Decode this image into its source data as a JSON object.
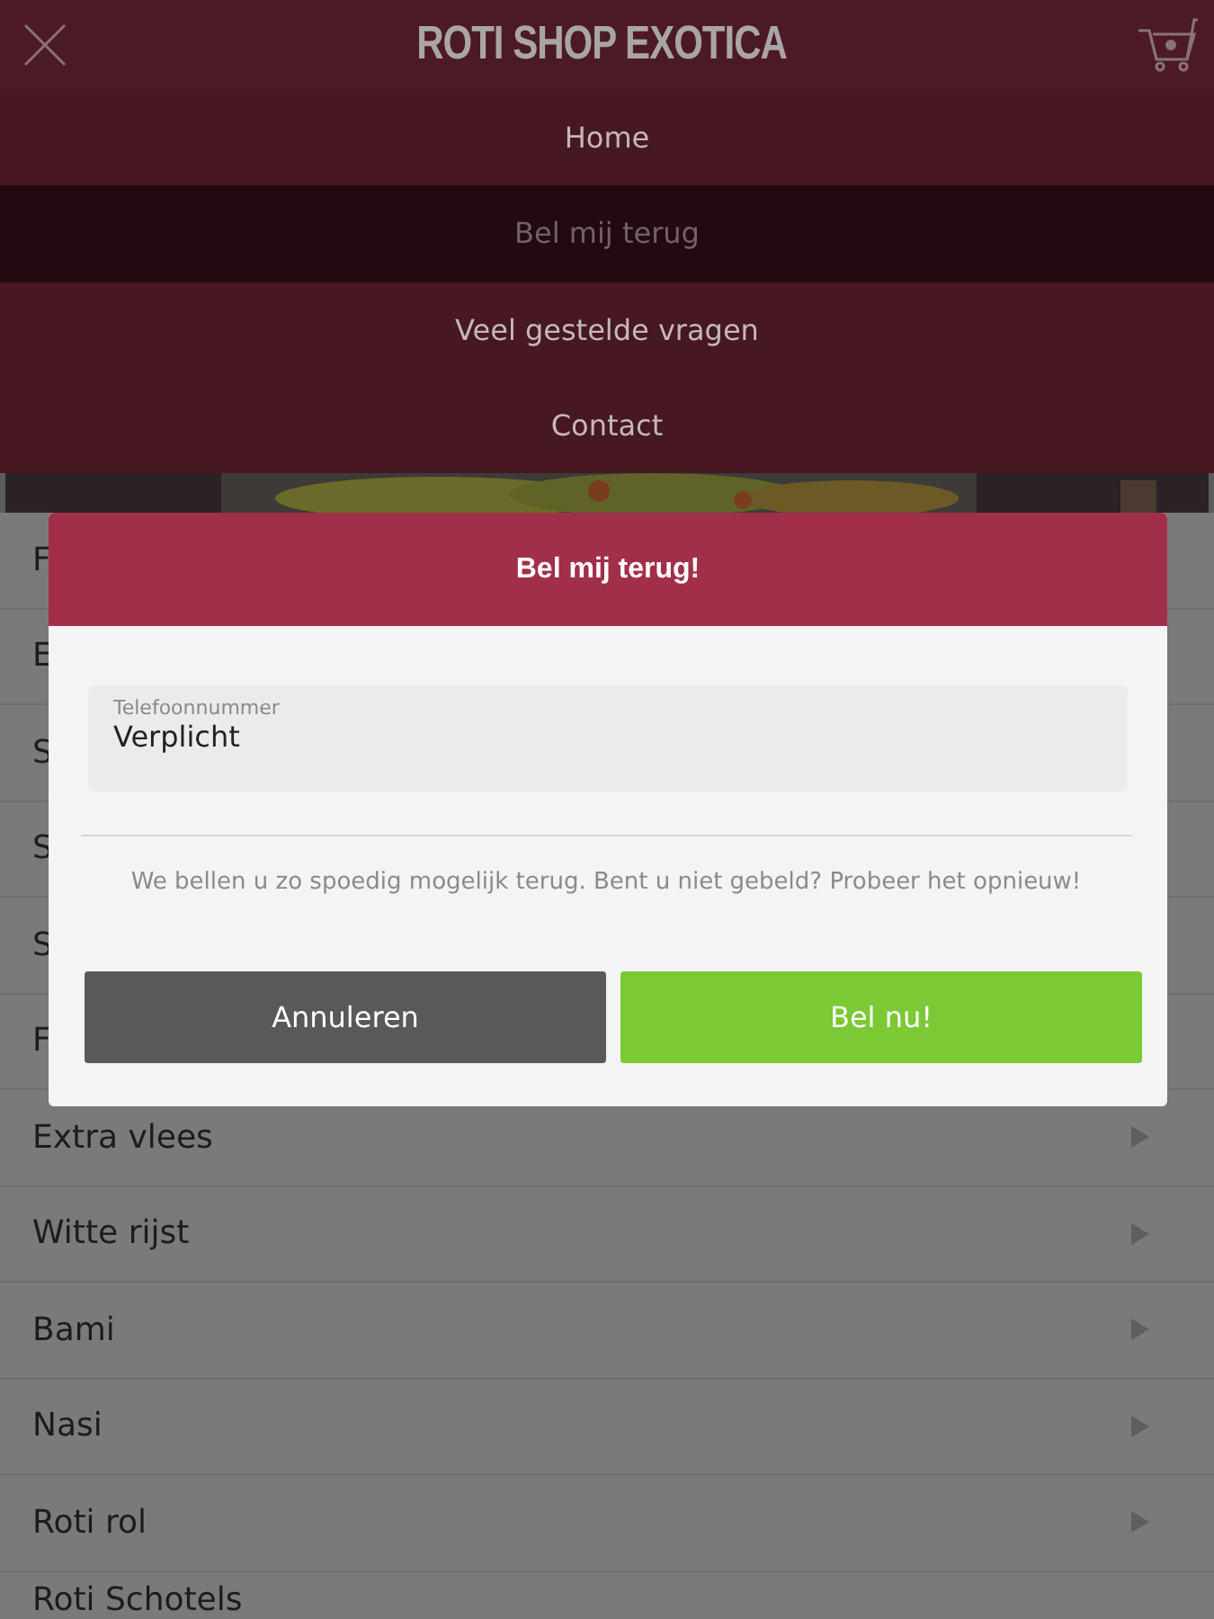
{
  "header": {
    "title": "ROTI SHOP EXOTICA"
  },
  "menu": [
    {
      "label": "Home",
      "selected": false
    },
    {
      "label": "Bel mij terug",
      "selected": true
    },
    {
      "label": "Veel gestelde vragen",
      "selected": false
    },
    {
      "label": "Contact",
      "selected": false
    }
  ],
  "categories": [
    {
      "label": "F"
    },
    {
      "label": "E"
    },
    {
      "label": "S"
    },
    {
      "label": "S"
    },
    {
      "label": "S"
    },
    {
      "label": "F"
    },
    {
      "label": "Extra vlees",
      "arrow": true
    },
    {
      "label": "Witte rijst",
      "arrow": true
    },
    {
      "label": "Bami",
      "arrow": true
    },
    {
      "label": "Nasi",
      "arrow": true
    },
    {
      "label": "Roti rol",
      "arrow": true
    },
    {
      "label": "Roti Schotels"
    }
  ],
  "dialog": {
    "title": "Bel mij terug!",
    "field": {
      "label": "Telefoonnummer",
      "placeholder": "Verplicht"
    },
    "message": "We bellen u zo spoedig mogelijk terug. Bent u niet gebeld? Probeer het opnieuw!",
    "buttons": [
      {
        "label": "Annuleren",
        "kind": "cancel"
      },
      {
        "label": "Bel nu!",
        "kind": "confirm"
      }
    ]
  }
}
